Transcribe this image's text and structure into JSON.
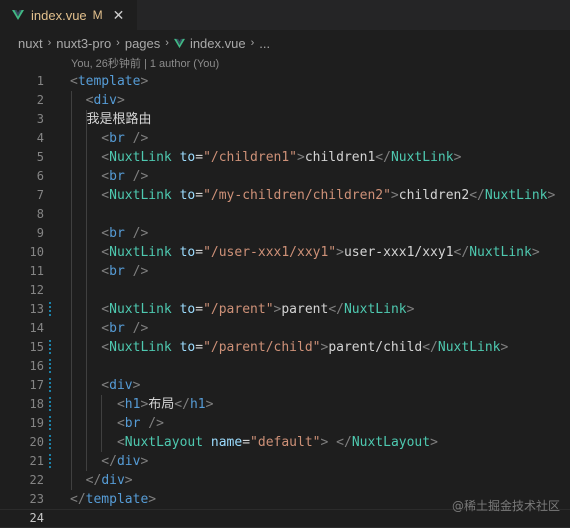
{
  "tab": {
    "filename": "index.vue",
    "modified_flag": "M",
    "close_glyph": "✕",
    "icon": "vue-icon",
    "accent_color": "#41b883"
  },
  "breadcrumb": {
    "items": [
      "nuxt",
      "nuxt3-pro",
      "pages",
      "index.vue",
      "..."
    ],
    "separator": "›"
  },
  "blame_text": "You, 26秒钟前 | 1 author (You)",
  "lines": [
    {
      "n": "1",
      "tokens": [
        [
          "tk-bracket",
          "<"
        ],
        [
          "tk-tag",
          "template"
        ],
        [
          "tk-bracket",
          ">"
        ]
      ]
    },
    {
      "n": "2",
      "tokens": [
        [
          "tk-bracket",
          "  <"
        ],
        [
          "tk-tag",
          "div"
        ],
        [
          "tk-bracket",
          ">"
        ]
      ]
    },
    {
      "n": "3",
      "tokens": [
        [
          "tk-text cjk",
          "    我是根路由"
        ]
      ]
    },
    {
      "n": "4",
      "tokens": [
        [
          "tk-bracket",
          "    <"
        ],
        [
          "tk-tag",
          "br"
        ],
        [
          "tk-bracket",
          " />"
        ]
      ]
    },
    {
      "n": "5",
      "tokens": [
        [
          "tk-bracket",
          "    <"
        ],
        [
          "tk-comp",
          "NuxtLink"
        ],
        [
          "tk-attr",
          " to"
        ],
        [
          "tk-eq",
          "="
        ],
        [
          "tk-str",
          "\"/children1\""
        ],
        [
          "tk-bracket",
          ">"
        ],
        [
          "tk-text",
          "children1"
        ],
        [
          "tk-bracket",
          "</"
        ],
        [
          "tk-comp",
          "NuxtLink"
        ],
        [
          "tk-bracket",
          ">"
        ]
      ]
    },
    {
      "n": "6",
      "tokens": [
        [
          "tk-bracket",
          "    <"
        ],
        [
          "tk-tag",
          "br"
        ],
        [
          "tk-bracket",
          " />"
        ]
      ]
    },
    {
      "n": "7",
      "tokens": [
        [
          "tk-bracket",
          "    <"
        ],
        [
          "tk-comp",
          "NuxtLink"
        ],
        [
          "tk-attr",
          " to"
        ],
        [
          "tk-eq",
          "="
        ],
        [
          "tk-str",
          "\"/my-children/children2\""
        ],
        [
          "tk-bracket",
          ">"
        ],
        [
          "tk-text",
          "children2"
        ],
        [
          "tk-bracket",
          "</"
        ],
        [
          "tk-comp",
          "NuxtLink"
        ],
        [
          "tk-bracket",
          ">"
        ]
      ]
    },
    {
      "n": "8",
      "tokens": []
    },
    {
      "n": "9",
      "tokens": [
        [
          "tk-bracket",
          "    <"
        ],
        [
          "tk-tag",
          "br"
        ],
        [
          "tk-bracket",
          " />"
        ]
      ]
    },
    {
      "n": "10",
      "tokens": [
        [
          "tk-bracket",
          "    <"
        ],
        [
          "tk-comp",
          "NuxtLink"
        ],
        [
          "tk-attr",
          " to"
        ],
        [
          "tk-eq",
          "="
        ],
        [
          "tk-str",
          "\"/user-xxx1/xxy1\""
        ],
        [
          "tk-bracket",
          ">"
        ],
        [
          "tk-text",
          "user-xxx1/xxy1"
        ],
        [
          "tk-bracket",
          "</"
        ],
        [
          "tk-comp",
          "NuxtLink"
        ],
        [
          "tk-bracket",
          ">"
        ]
      ]
    },
    {
      "n": "11",
      "tokens": [
        [
          "tk-bracket",
          "    <"
        ],
        [
          "tk-tag",
          "br"
        ],
        [
          "tk-bracket",
          " />"
        ]
      ]
    },
    {
      "n": "12",
      "tokens": []
    },
    {
      "n": "13",
      "tokens": [
        [
          "tk-bracket",
          "    <"
        ],
        [
          "tk-comp",
          "NuxtLink"
        ],
        [
          "tk-attr",
          " to"
        ],
        [
          "tk-eq",
          "="
        ],
        [
          "tk-str",
          "\"/parent\""
        ],
        [
          "tk-bracket",
          ">"
        ],
        [
          "tk-text",
          "parent"
        ],
        [
          "tk-bracket",
          "</"
        ],
        [
          "tk-comp",
          "NuxtLink"
        ],
        [
          "tk-bracket",
          ">"
        ]
      ],
      "mark": true
    },
    {
      "n": "14",
      "tokens": [
        [
          "tk-bracket",
          "    <"
        ],
        [
          "tk-tag",
          "br"
        ],
        [
          "tk-bracket",
          " />"
        ]
      ]
    },
    {
      "n": "15",
      "tokens": [
        [
          "tk-bracket",
          "    <"
        ],
        [
          "tk-comp",
          "NuxtLink"
        ],
        [
          "tk-attr",
          " to"
        ],
        [
          "tk-eq",
          "="
        ],
        [
          "tk-str",
          "\"/parent/child\""
        ],
        [
          "tk-bracket",
          ">"
        ],
        [
          "tk-text",
          "parent/child"
        ],
        [
          "tk-bracket",
          "</"
        ],
        [
          "tk-comp",
          "NuxtLink"
        ],
        [
          "tk-bracket",
          ">"
        ]
      ],
      "mark": true
    },
    {
      "n": "16",
      "tokens": [],
      "mark": true
    },
    {
      "n": "17",
      "tokens": [
        [
          "tk-bracket",
          "    <"
        ],
        [
          "tk-tag",
          "div"
        ],
        [
          "tk-bracket",
          ">"
        ]
      ],
      "mark": true
    },
    {
      "n": "18",
      "tokens": [
        [
          "tk-bracket",
          "      <"
        ],
        [
          "tk-tag",
          "h1"
        ],
        [
          "tk-bracket",
          ">"
        ],
        [
          "tk-text cjk",
          "布局"
        ],
        [
          "tk-bracket",
          "</"
        ],
        [
          "tk-tag",
          "h1"
        ],
        [
          "tk-bracket",
          ">"
        ]
      ],
      "mark": true
    },
    {
      "n": "19",
      "tokens": [
        [
          "tk-bracket",
          "      <"
        ],
        [
          "tk-tag",
          "br"
        ],
        [
          "tk-bracket",
          " />"
        ]
      ],
      "mark": true
    },
    {
      "n": "20",
      "tokens": [
        [
          "tk-bracket",
          "      <"
        ],
        [
          "tk-comp",
          "NuxtLayout"
        ],
        [
          "tk-attr",
          " name"
        ],
        [
          "tk-eq",
          "="
        ],
        [
          "tk-str",
          "\"default\""
        ],
        [
          "tk-bracket",
          "> </"
        ],
        [
          "tk-comp",
          "NuxtLayout"
        ],
        [
          "tk-bracket",
          ">"
        ]
      ],
      "mark": true
    },
    {
      "n": "21",
      "tokens": [
        [
          "tk-bracket",
          "    </"
        ],
        [
          "tk-tag",
          "div"
        ],
        [
          "tk-bracket",
          ">"
        ]
      ],
      "mark": true
    },
    {
      "n": "22",
      "tokens": [
        [
          "tk-bracket",
          "  </"
        ],
        [
          "tk-tag",
          "div"
        ],
        [
          "tk-bracket",
          ">"
        ]
      ]
    },
    {
      "n": "23",
      "tokens": [
        [
          "tk-bracket",
          "</"
        ],
        [
          "tk-tag",
          "template"
        ],
        [
          "tk-bracket",
          ">"
        ]
      ]
    },
    {
      "n": "24",
      "tokens": [],
      "current": true
    }
  ],
  "watermark": "@稀土掘金技术社区"
}
